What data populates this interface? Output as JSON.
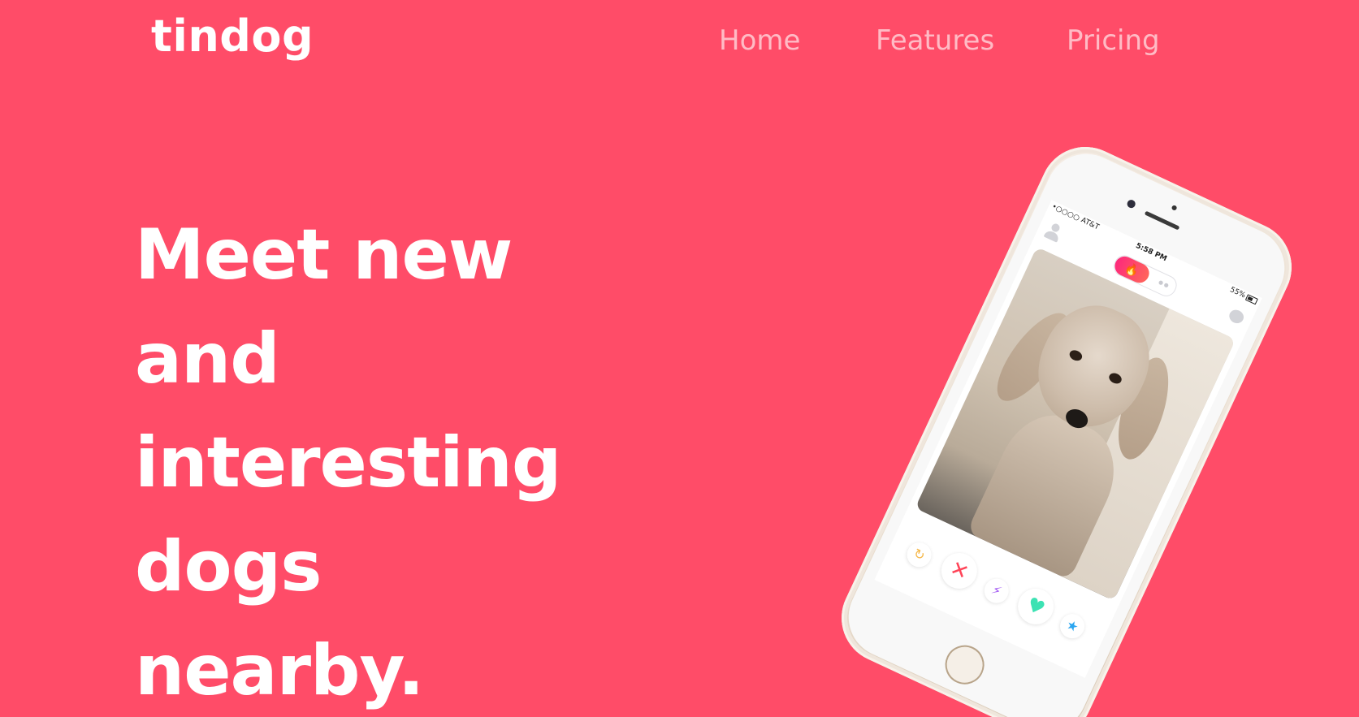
{
  "nav": {
    "brand": "tindog",
    "links": [
      "Home",
      "Features",
      "Pricing"
    ]
  },
  "hero": {
    "headline_lines": [
      "Meet new",
      "and",
      "interesting",
      "dogs",
      "nearby."
    ]
  },
  "phone": {
    "status": {
      "carrier": "•○○○○ AT&T",
      "time": "5:58 PM",
      "battery": "55%"
    },
    "icons": {
      "undo": "undo-icon",
      "nope": "close-icon",
      "boost": "bolt-icon",
      "like": "heart-icon",
      "super_like": "star-icon"
    }
  },
  "colors": {
    "background": "#ff4c68",
    "headline": "#ffffff",
    "nav_link": "#ffb1bd"
  }
}
